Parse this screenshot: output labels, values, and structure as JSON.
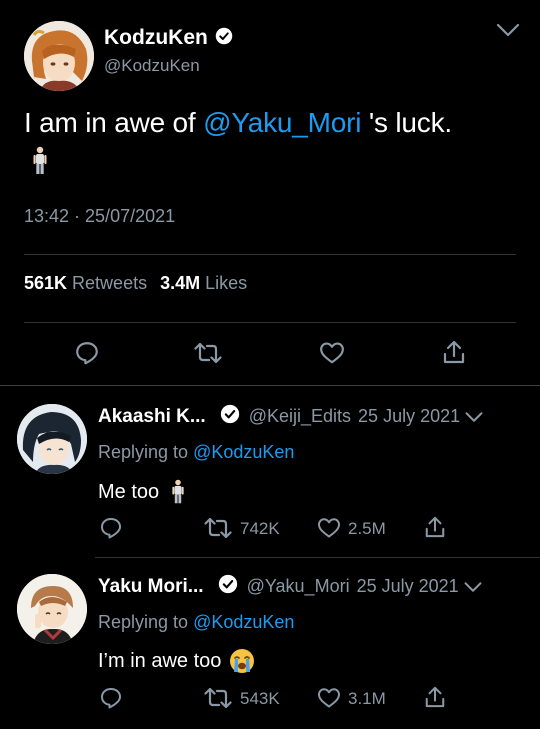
{
  "main": {
    "display_name": "KodzuKen",
    "handle": "@KodzuKen",
    "text_prefix": "I am in awe of ",
    "mention": "@Yaku_Mori",
    "text_suffix": " 's luck.",
    "timestamp": "13:42 · 25/07/2021",
    "retweets_count": "561K",
    "retweets_label": "Retweets",
    "likes_count": "3.4M",
    "likes_label": "Likes"
  },
  "replies": [
    {
      "display_name": "Akaashi K...",
      "handle": "@Keiji_Edits",
      "date": "25 July 2021",
      "replying_label": "Replying to ",
      "replying_to": "@KodzuKen",
      "text": "Me too",
      "retweets": "742K",
      "likes": "2.5M"
    },
    {
      "display_name": "Yaku Mori...",
      "handle": "@Yaku_Mori",
      "date": "25 July 2021",
      "replying_label": "Replying to ",
      "replying_to": "@KodzuKen",
      "text": "I’m in awe too",
      "retweets": "543K",
      "likes": "3.1M"
    }
  ],
  "colors": {
    "background": "#000000",
    "accent": "#1d9bf0",
    "secondary_text": "#8b98a5"
  }
}
